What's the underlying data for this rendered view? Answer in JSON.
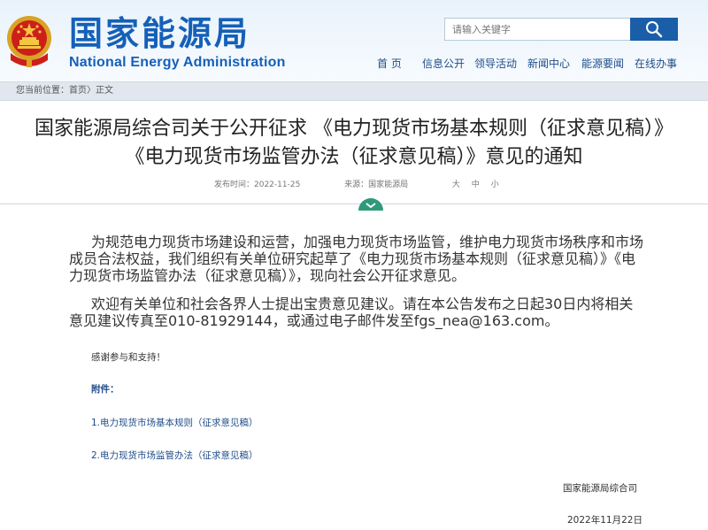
{
  "header": {
    "title_cn": "国家能源局",
    "title_en": "National Energy Administration",
    "search_placeholder": "请输入关键字",
    "icons": {
      "emblem": "national-emblem-icon",
      "search": "search-icon"
    },
    "colors": {
      "brand": "#1560b8",
      "search_button": "#1b5ea8"
    }
  },
  "nav": {
    "items": [
      {
        "label": "首 页"
      },
      {
        "label": "信息公开"
      },
      {
        "label": "领导活动"
      },
      {
        "label": "新闻中心"
      },
      {
        "label": "能源要闻"
      },
      {
        "label": "在线办事"
      }
    ]
  },
  "breadcrumb": {
    "prefix": "您当前位置：",
    "home": "首页",
    "sep": "〉",
    "current": "正文"
  },
  "article": {
    "title": "国家能源局综合司关于公开征求 《电力现货市场基本规则（征求意见稿）》《电力现货市场监管办法（征求意见稿）》意见的通知",
    "publish_label": "发布时间：2022-11-25",
    "source_label": "来源：国家能源局",
    "size_large": "大",
    "size_medium": "中",
    "size_small": "小",
    "paragraphs": {
      "p1": "为规范电力现货市场建设和运营，加强电力现货市场监管，维护电力现货市场秩序和市场成员合法权益，我们组织有关单位研究起草了《电力现货市场基本规则（征求意见稿）》《电力现货市场监管办法（征求意见稿）》，现向社会公开征求意见。",
      "p2": "欢迎有关单位和社会各界人士提出宝贵意见建议。请在本公告发布之日起30日内将相关意见建议传真至010-81929144，或通过电子邮件发至fgs_nea@163.com。",
      "p3": "感谢参与和支持！",
      "attachments_label": "附件：",
      "attachment1": "1.电力现货市场基本规则（征求意见稿）",
      "attachment2": "2.电力现货市场监管办法（征求意见稿）",
      "signature": "国家能源局综合司",
      "date": "2022年11月22日"
    }
  }
}
